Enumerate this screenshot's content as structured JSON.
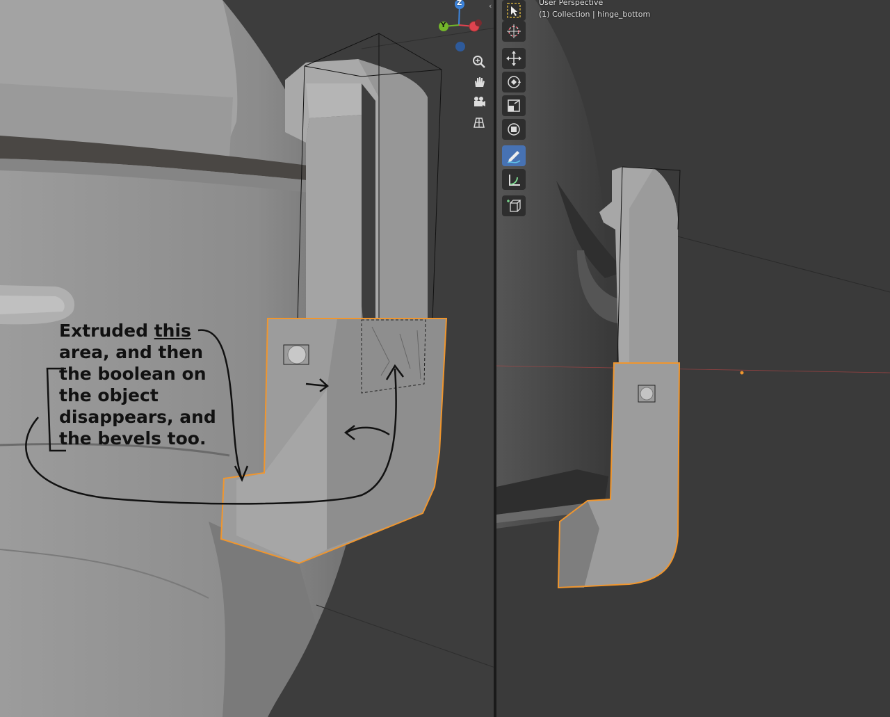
{
  "viewport_right": {
    "perspective": "User Perspective",
    "collection_object": "(1) Collection | hinge_bottom"
  },
  "gizmo": {
    "z": "Z",
    "y": "Y"
  },
  "annotation": {
    "line1_pre": "Extruded ",
    "line1_ul": "this",
    "line2": "area, and then",
    "line3": "the boolean on",
    "line4": "the object",
    "line5": "disappears, and",
    "line6": "the bevels too."
  },
  "nav_buttons": [
    "zoom-icon",
    "hand-pan-icon",
    "camera-icon",
    "grid-view-icon"
  ],
  "tools": [
    "select-box-icon",
    "cursor-icon",
    "move-icon",
    "rotate-icon",
    "scale-icon",
    "transform-icon",
    "annotate-icon",
    "measure-icon",
    "add-cube-icon"
  ],
  "colors": {
    "selection_outline": "#f0962e",
    "active_tool": "#4772b3",
    "gizmo_x": "#e0434f",
    "gizmo_y": "#73b52a",
    "gizmo_z": "#3d86e0"
  }
}
